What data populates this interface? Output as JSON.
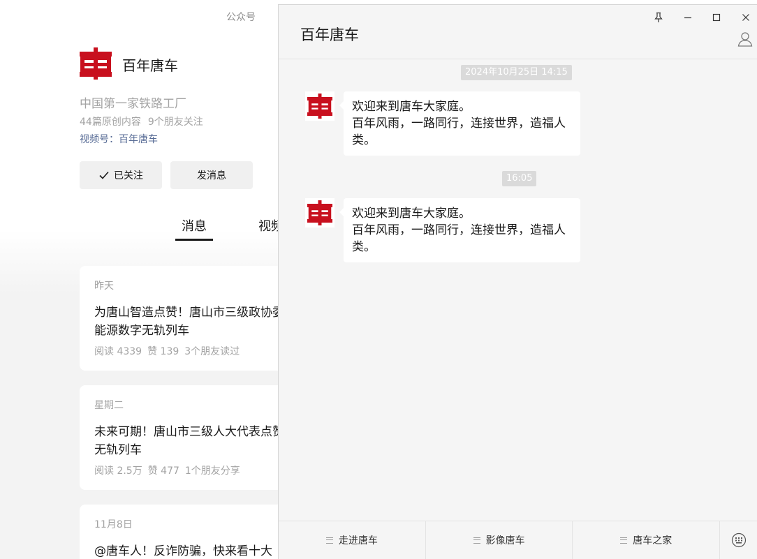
{
  "profile": {
    "topbar_label": "公众号",
    "account_name": "百年唐车",
    "description": "中国第一家铁路工厂",
    "stats": {
      "articles": "44篇原创内容",
      "friends": "9个朋友关注"
    },
    "channel": "视频号：百年唐车",
    "follow_label": "已关注",
    "message_label": "发消息",
    "tabs": [
      "消息",
      "视频"
    ],
    "articles": [
      {
        "date": "昨天",
        "title": "为唐山智造点赞！唐山市三级政协委员 新能源数字无轨列车",
        "reads": "阅读 4339",
        "likes": "赞 139",
        "social": "3个朋友读过"
      },
      {
        "date": "星期二",
        "title": "未来可期！唐山市三级人大代表点赞 数字无轨列车",
        "reads": "阅读 2.5万",
        "likes": "赞 477",
        "social": "1个朋友分享"
      },
      {
        "date": "11月8日",
        "title": "@唐车人！反诈防骗，快来看十大"
      }
    ]
  },
  "chat": {
    "title": "百年唐车",
    "timestamps": [
      "2024年10月25日 14:15",
      "16:05"
    ],
    "messages": [
      {
        "line1": "欢迎来到唐车大家庭。",
        "line2": "百年风雨，一路同行，连接世界，造福人类。"
      },
      {
        "line1": "欢迎来到唐车大家庭。",
        "line2": "百年风雨，一路同行，连接世界，造福人类。"
      }
    ],
    "menu": [
      "走进唐车",
      "影像唐车",
      "唐车之家"
    ]
  },
  "colors": {
    "brand_red": "#c8101e",
    "link_blue": "#576b95",
    "muted_text": "#a3a3a3"
  }
}
